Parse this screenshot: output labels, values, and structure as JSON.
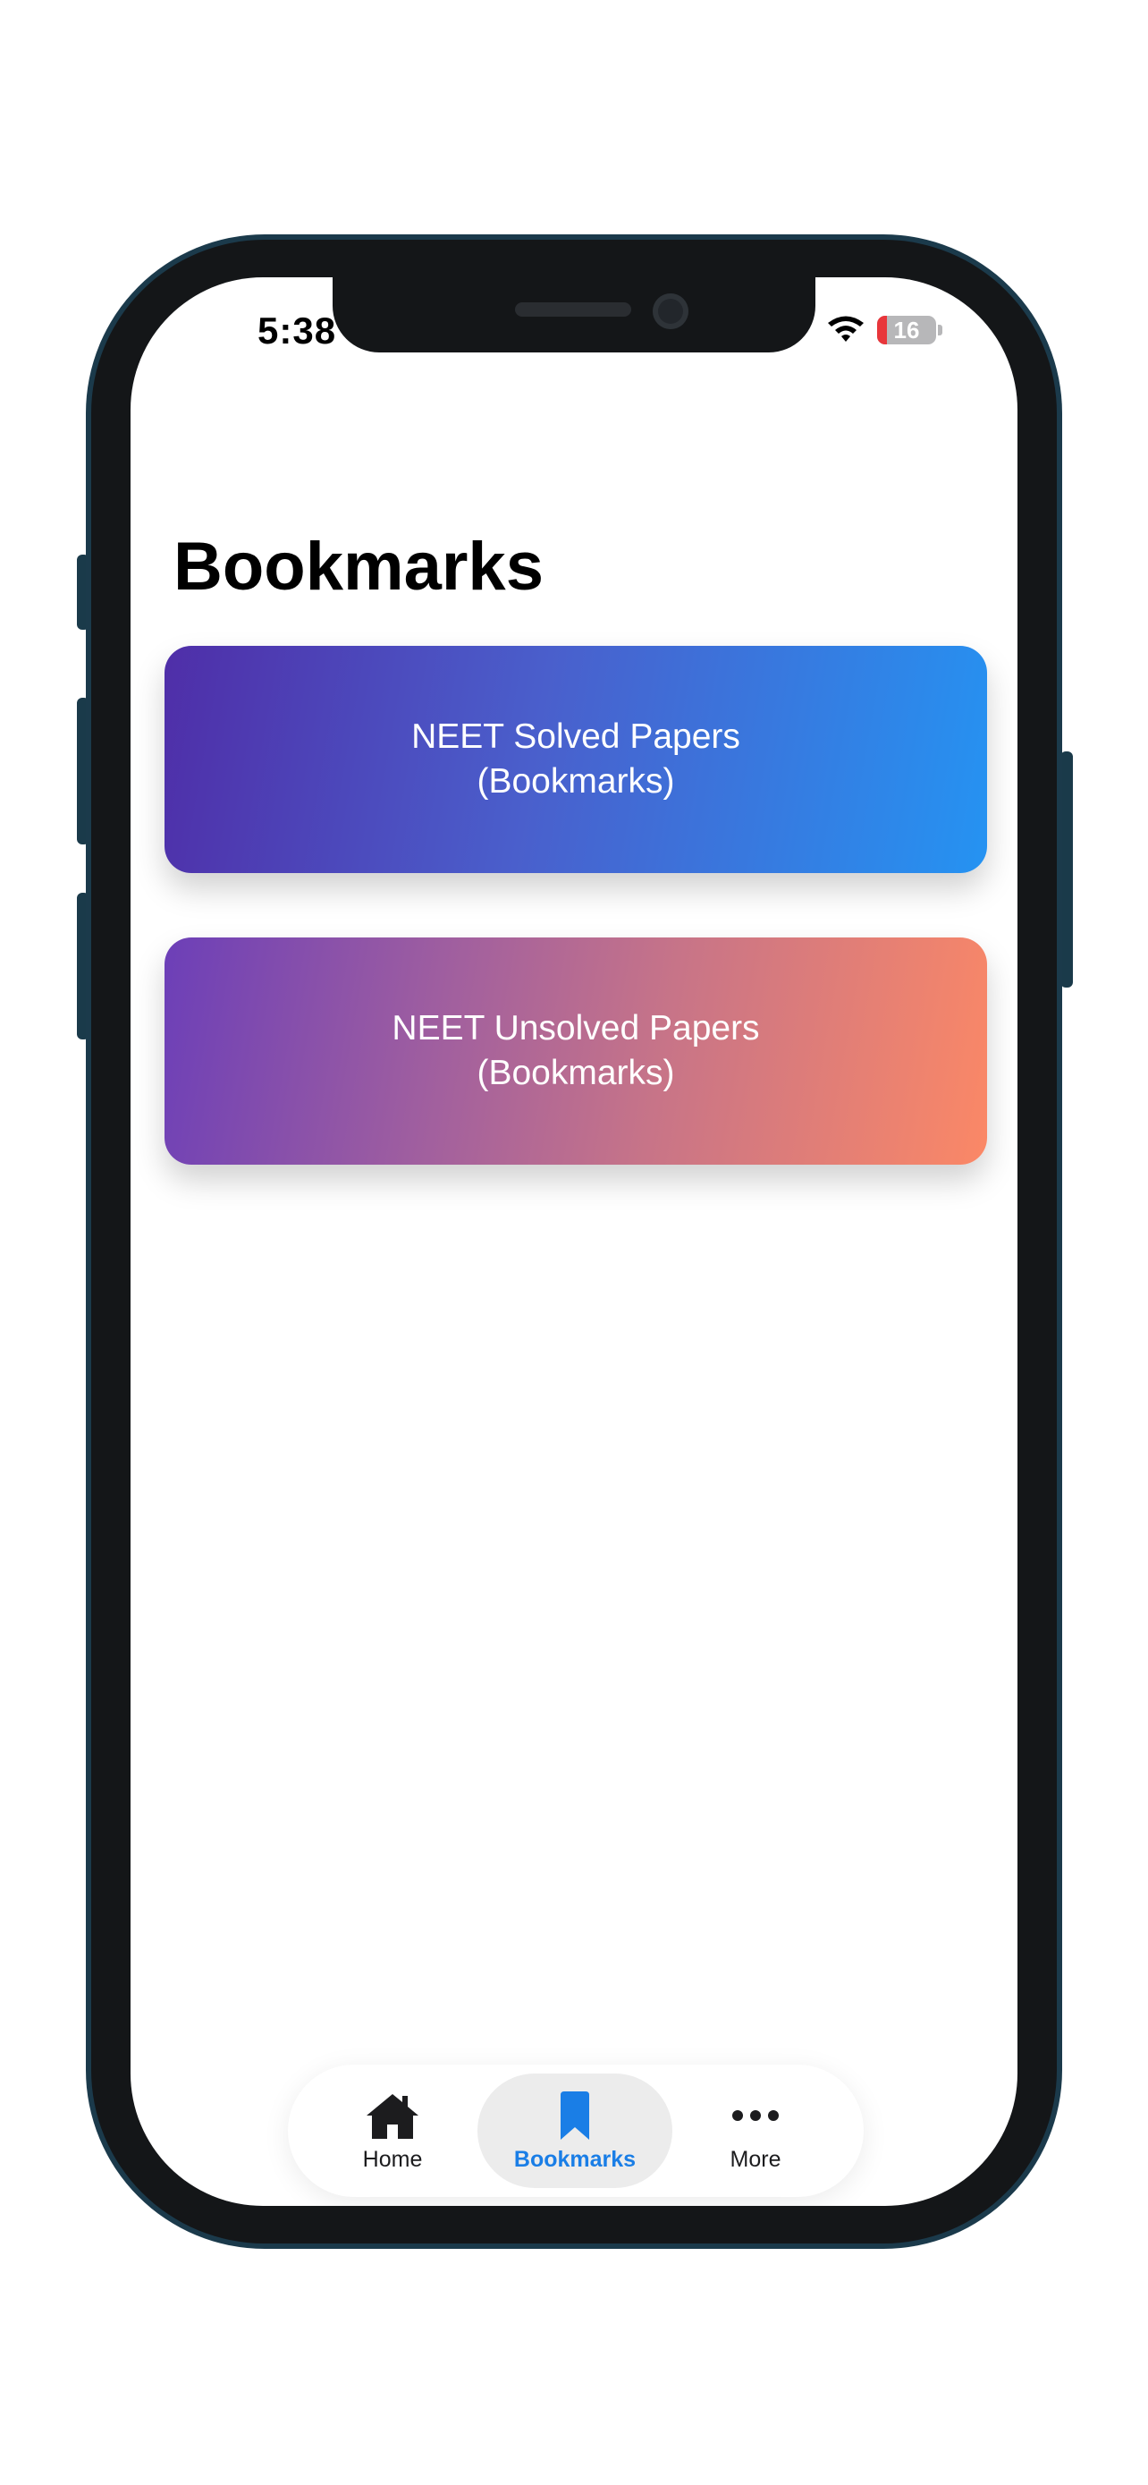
{
  "status_bar": {
    "time": "5:38",
    "battery_level": "16",
    "battery_fraction": 0.16,
    "icons": [
      "wifi-icon",
      "battery-icon"
    ]
  },
  "page": {
    "title": "Bookmarks"
  },
  "cards": [
    {
      "line1": "NEET Solved Papers",
      "line2": "(Bookmarks)",
      "gradient": [
        "#4f2ea8",
        "#2593f2"
      ]
    },
    {
      "line1": "NEET Unsolved Papers",
      "line2": "(Bookmarks)",
      "gradient": [
        "#6c3fb8",
        "#fb8866"
      ]
    }
  ],
  "tab_bar": {
    "items": [
      {
        "label": "Home",
        "icon": "home-icon"
      },
      {
        "label": "Bookmarks",
        "icon": "bookmark-icon",
        "selected": true
      },
      {
        "label": "More",
        "icon": "more-icon"
      }
    ],
    "active_color": "#1a7ee6"
  }
}
